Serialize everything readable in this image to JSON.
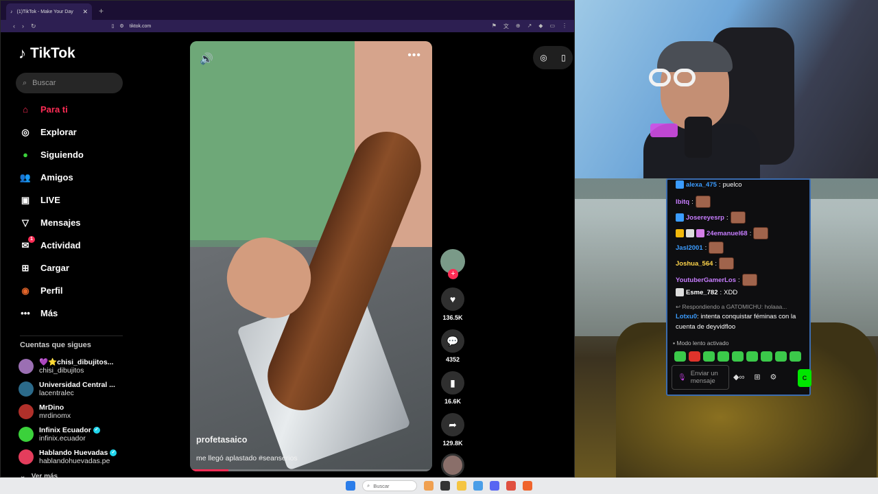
{
  "browser": {
    "tab_title": "(1)TikTok - Make Your Day",
    "new_tab": "+",
    "url": "tiktok.com"
  },
  "sidebar": {
    "logo": "TikTok",
    "search_placeholder": "Buscar",
    "nav": [
      {
        "label": "Para ti",
        "icon": "home-icon",
        "active": true
      },
      {
        "label": "Explorar",
        "icon": "compass-icon"
      },
      {
        "label": "Siguiendo",
        "icon": "following-icon"
      },
      {
        "label": "Amigos",
        "icon": "friends-icon"
      },
      {
        "label": "LIVE",
        "icon": "live-icon"
      },
      {
        "label": "Mensajes",
        "icon": "send-icon"
      },
      {
        "label": "Actividad",
        "icon": "activity-icon",
        "badge": "1"
      },
      {
        "label": "Cargar",
        "icon": "upload-icon"
      },
      {
        "label": "Perfil",
        "icon": "profile-avatar-icon"
      },
      {
        "label": "Más",
        "icon": "more-dots-icon"
      }
    ],
    "following_header": "Cuentas que sigues",
    "following": [
      {
        "name": "💜⭐chisi_dibujitos...",
        "handle": "chisi_dibujitos",
        "verified": false,
        "color": "#9b6fb3"
      },
      {
        "name": "Universidad Central ...",
        "handle": "lacentralec",
        "verified": false,
        "color": "#2b6a8a"
      },
      {
        "name": "MrDino",
        "handle": "mrdinomx",
        "verified": false,
        "color": "#b0302a"
      },
      {
        "name": "Infinix Ecuador",
        "handle": "infinix.ecuador",
        "verified": true,
        "color": "#3bd13b"
      },
      {
        "name": "Hablando Huevadas",
        "handle": "hablandohuevadas.pe",
        "verified": true,
        "color": "#e43d5c"
      }
    ],
    "see_more": "Ver más"
  },
  "video": {
    "username": "profetasaico",
    "description": "me llegó aplastado #seanserios",
    "progress": 0.16,
    "likes": "136.5K",
    "comments": "4352",
    "saves": "16.6K",
    "shares": "129.8K"
  },
  "chat": {
    "messages": [
      {
        "user": "alexa_475",
        "text": "puelco",
        "color": "#3b9cff",
        "badges": [
          "#3b9cff"
        ],
        "emote": false
      },
      {
        "user": "lbitq",
        "text": "",
        "color": "#c77dff",
        "badges": [],
        "emote": true
      },
      {
        "user": "Josereyesrp",
        "text": "",
        "color": "#c77dff",
        "badges": [
          "#3b9cff"
        ],
        "emote": true
      },
      {
        "user": "24emanuel68",
        "text": "",
        "color": "#c77dff",
        "badges": [
          "#f2b90c",
          "#dddddd",
          "#d47ee8"
        ],
        "emote": true
      },
      {
        "user": "Jasl2001",
        "text": "",
        "color": "#3b9cff",
        "badges": [],
        "emote": true
      },
      {
        "user": "Joshua_564",
        "text": "",
        "color": "#ffd54a",
        "badges": [],
        "emote": true
      },
      {
        "user": "YoutuberGamerLos",
        "text": "",
        "color": "#c77dff",
        "badges": [],
        "emote": true
      },
      {
        "user": "Esme_782",
        "text": "XDD",
        "color": "#ffffff",
        "badges": [
          "#dddddd"
        ],
        "emote": false
      }
    ],
    "reply_to": "Respondiendo a GATOMICHU: holaaa...",
    "reply_user": "Lotxu0",
    "reply_text": "intenta conquistar féminas con la cuenta de deyvidfloo",
    "slow_mode": "Modo lento activado",
    "input_placeholder": "Enviar un mensaje",
    "send_label": "C"
  },
  "taskbar": {
    "search": "Buscar"
  },
  "colors": {
    "accent": "#fe2c55",
    "twitch_border": "#3b6cb0"
  }
}
